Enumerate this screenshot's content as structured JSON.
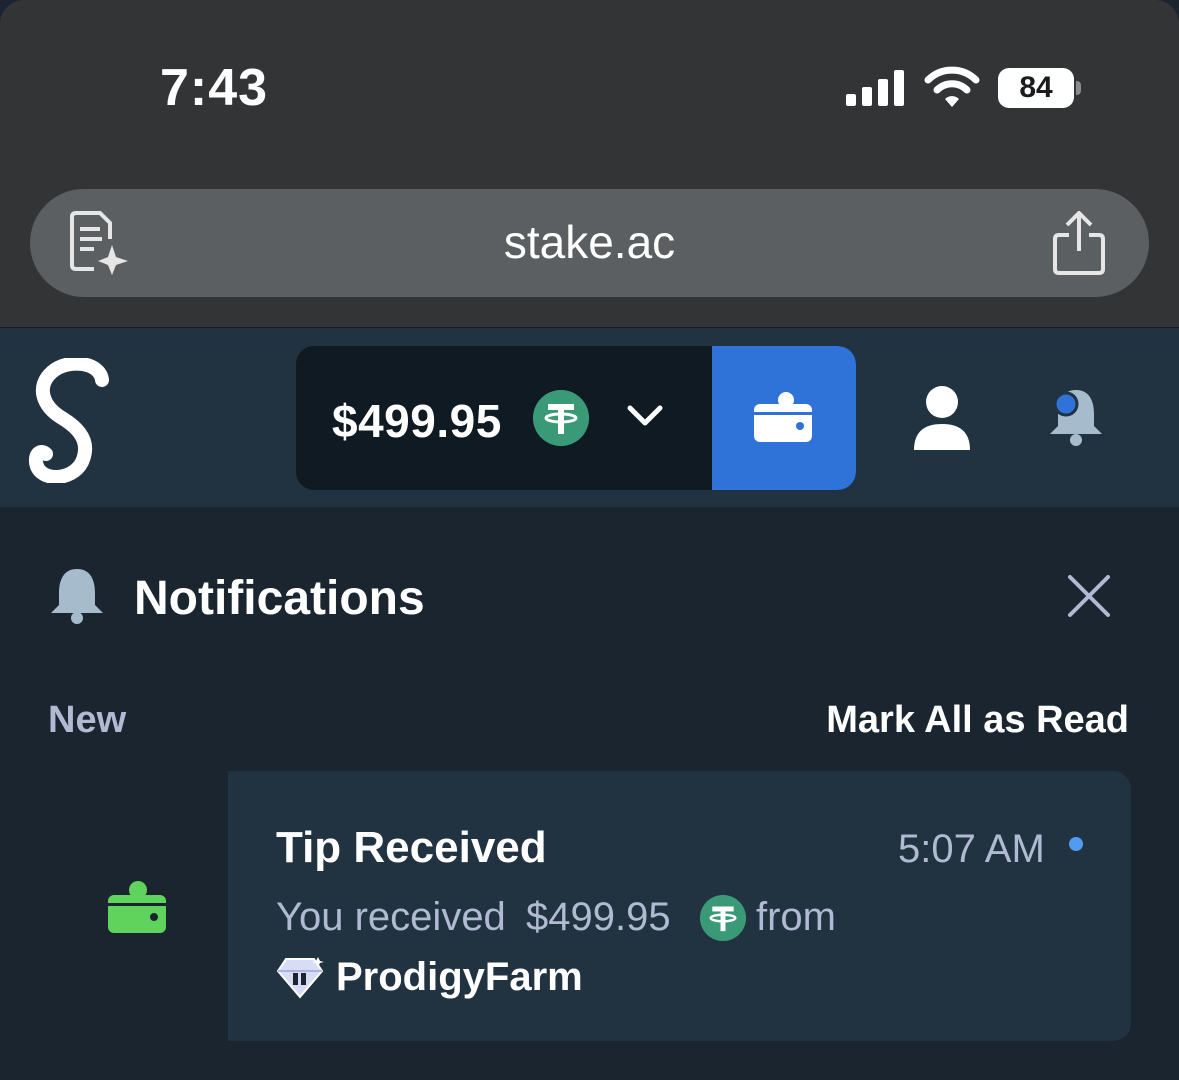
{
  "status_bar": {
    "time": "7:43",
    "battery": "84"
  },
  "browser": {
    "url": "stake.ac"
  },
  "header": {
    "balance": "$499.95",
    "currency_icon": "tether-icon",
    "accent_color": "#2f72d8"
  },
  "notifications": {
    "title": "Notifications",
    "section_label": "New",
    "mark_all_label": "Mark All as Read",
    "items": [
      {
        "title": "Tip Received",
        "time": "5:07 AM",
        "text_prefix": "You received",
        "amount": "$499.95",
        "text_suffix": "from",
        "user": "ProdigyFarm",
        "icon": "wallet-icon",
        "icon_color": "#5fd35c",
        "unread": true
      }
    ]
  }
}
